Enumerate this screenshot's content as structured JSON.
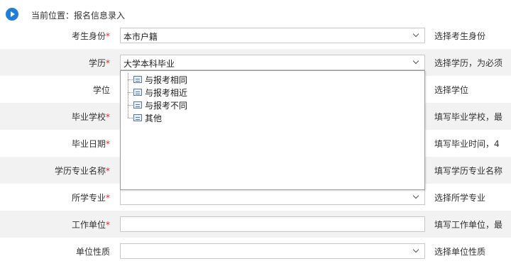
{
  "breadcrumb": {
    "text": "当前位置：报名信息录入"
  },
  "rows": [
    {
      "label": "考生身份",
      "required": "*",
      "value": "本市户籍",
      "hint": "选择考生身份"
    },
    {
      "label": "学历",
      "required": "*",
      "value": "大学本科毕业",
      "hint": "选择学历，为必须"
    },
    {
      "label": "学位",
      "required": "",
      "value": "",
      "hint": "选择学位"
    },
    {
      "label": "毕业学校",
      "required": "*",
      "value": "",
      "hint": "填写毕业学校，最"
    },
    {
      "label": "毕业日期",
      "required": "*",
      "value": "",
      "hint": "填写毕业时间，4"
    },
    {
      "label": "学历专业名称",
      "required": "*",
      "value": "",
      "hint": "填写学历专业名称"
    },
    {
      "label": "所学专业",
      "required": "*",
      "value": "",
      "hint": "选择所学专业"
    },
    {
      "label": "工作单位",
      "required": "*",
      "value": "",
      "hint": "填写工作单位，最"
    },
    {
      "label": "单位性质",
      "required": "",
      "value": "",
      "hint": "选择单位性质"
    }
  ],
  "dropdown": {
    "options": [
      "与报考相同",
      "与报考相近",
      "与报考不同",
      "其他"
    ]
  },
  "colors": {
    "accent": "#1f7fd8",
    "required": "#e0252b",
    "row_alt": "#f2f2f2"
  }
}
